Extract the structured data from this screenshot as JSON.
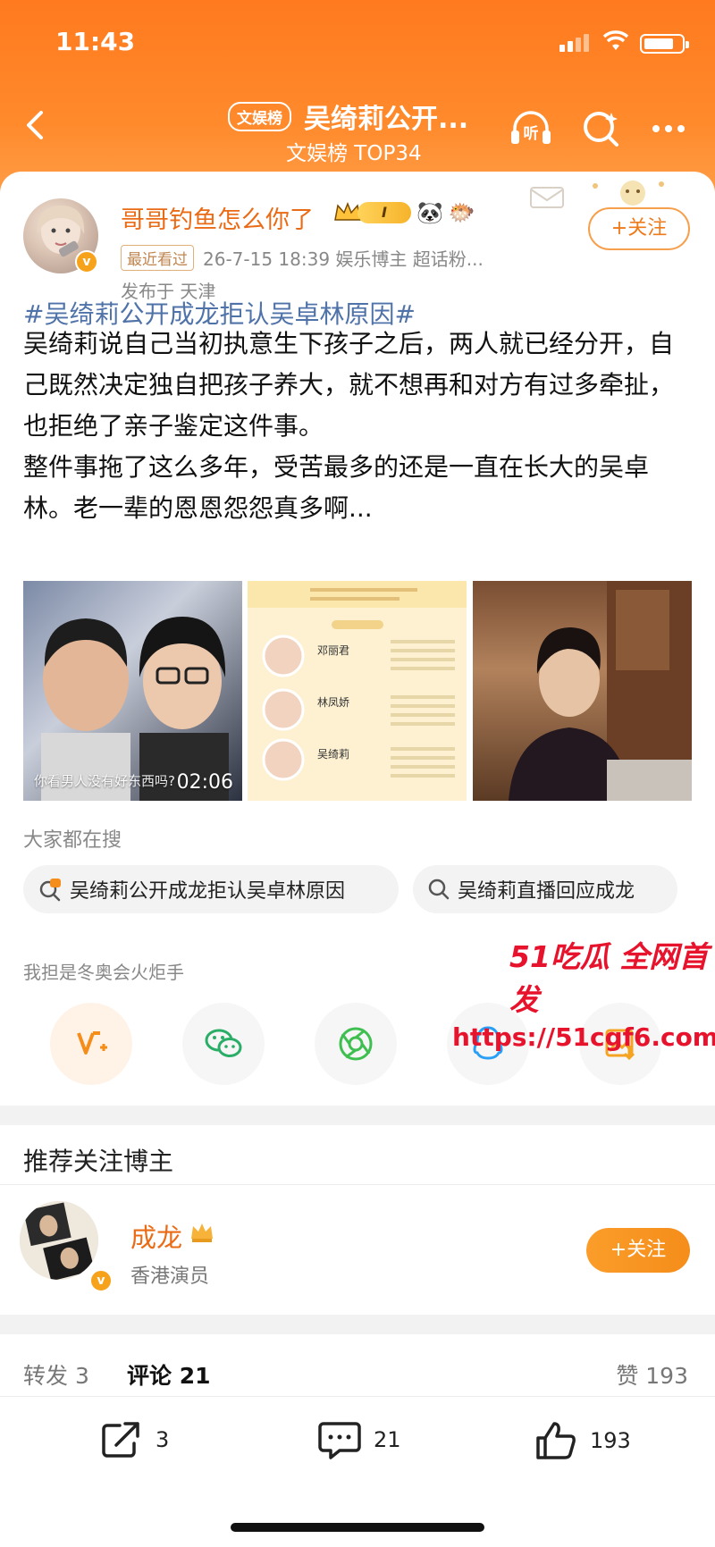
{
  "status_bar": {
    "time": "11:43"
  },
  "header": {
    "tag": "文娱榜",
    "title": "吴绮莉公开...",
    "subtitle": "文娱榜 TOP34",
    "listen_icon": "headphones-listen-icon",
    "search_icon": "search-sparkle-icon",
    "more_icon": "more-dots-icon"
  },
  "post": {
    "author": "哥哥钓鱼怎么你了",
    "vip_level": "I",
    "recent_tag": "最近看过",
    "meta": "26-7-15 18:39  娱乐博主 超话粉...",
    "location": "发布于 天津",
    "follow_label": "+关注",
    "hashtag": "#吴绮莉公开成龙拒认吴卓林原因#",
    "paragraphs": [
      "吴绮莉说自己当初执意生下孩子之后，两人就已经分开，自己既然决定独自把孩子养大，就不想再和对方有过多牵扯，也拒绝了亲子鉴定这件事。",
      "整件事拖了这么多年，受苦最多的还是一直在长大的吴卓林。老一辈的恩恩怨怨真多啊..."
    ],
    "video_caption": "你看男人没有好东西吗?",
    "video_duration": "02:06",
    "info_names": [
      "邓丽君",
      "林凤娇",
      "吴绮莉"
    ]
  },
  "search": {
    "label": "大家都在搜",
    "items": [
      "吴绮莉公开成龙拒认吴卓林原因",
      "吴绮莉直播回应成龙"
    ]
  },
  "share": {
    "hint": "我担是冬奥会火炬手",
    "icons": [
      "weibo-v-plus-icon",
      "wechat-icon",
      "moments-icon",
      "qq-icon",
      "save-image-icon"
    ]
  },
  "watermark": {
    "line1": "51吃瓜 全网首发",
    "line2": "https://51cgf6.com"
  },
  "recommend": {
    "title": "推荐关注博主",
    "name": "成龙",
    "desc": "香港演员",
    "follow_label": "+关注"
  },
  "tabs": {
    "repost": "转发 3",
    "comment": "评论 21",
    "like": "赞 193"
  },
  "actions": {
    "repost": "3",
    "comment": "21",
    "like": "193"
  },
  "colors": {
    "brand_orange": "#ff7a1e",
    "name_orange": "#ea6b16",
    "link_blue": "#4f73a8",
    "watermark_red": "#e7132c"
  }
}
